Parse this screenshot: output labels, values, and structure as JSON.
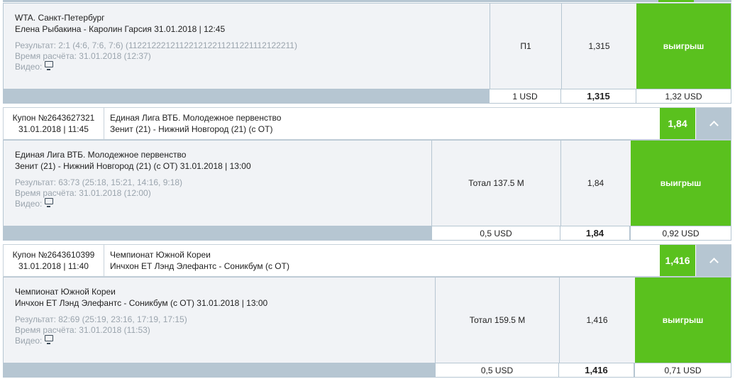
{
  "bet1": {
    "league": "WTA. Санкт-Петербург",
    "match": "Елена Рыбакина - Каролин Гарсия 31.01.2018 | 12:45",
    "result": "Результат: 2:1 (4:6, 7:6, 7:6) (112212221211221212211211221112122211)",
    "calc_time": "Время расчёта: 31.01.2018 (12:37)",
    "video_label": "Видео:",
    "outcome": "П1",
    "odds": "1,315",
    "status": "выигрыш",
    "stake": "1 USD",
    "total_odds": "1,315",
    "payout": "1,32 USD"
  },
  "coupon2": {
    "number": "Купон №2643627321",
    "date": "31.01.2018 | 11:45",
    "league": "Единая Лига ВТБ. Молодежное первенство",
    "teams": "Зенит (21) - Нижний Новгород (21) (с ОТ)",
    "coef": "1,84",
    "bet": {
      "league": "Единая Лига ВТБ. Молодежное первенство",
      "match": "Зенит (21) - Нижний Новгород (21) (с ОТ) 31.01.2018 | 13:00",
      "result": "Результат: 63:73 (25:18, 15:21, 14:16, 9:18)",
      "calc_time": "Время расчёта: 31.01.2018 (12:00)",
      "video_label": "Видео:",
      "outcome": "Тотал 137.5 М",
      "odds": "1,84",
      "status": "выигрыш",
      "stake": "0,5 USD",
      "total_odds": "1,84",
      "payout": "0,92 USD"
    }
  },
  "coupon3": {
    "number": "Купон №2643610399",
    "date": "31.01.2018 | 11:40",
    "league": "Чемпионат Южной Кореи",
    "teams": "Инчхон ЕТ Лэнд Элефантс - Соникбум (с ОТ)",
    "coef": "1,416",
    "bet": {
      "league": "Чемпионат Южной Кореи",
      "match": "Инчхон ЕТ Лэнд Элефантс - Соникбум (с ОТ) 31.01.2018 | 13:00",
      "result": "Результат: 82:69 (25:19, 23:16, 17:19, 17:15)",
      "calc_time": "Время расчёта: 31.01.2018 (11:53)",
      "video_label": "Видео:",
      "outcome": "Тотал 159.5 М",
      "odds": "1,416",
      "status": "выигрыш",
      "stake": "0,5 USD",
      "total_odds": "1,416",
      "payout": "0,71 USD"
    }
  },
  "colors": {
    "win_green": "#5ac11e",
    "footer_blue": "#b6c6d2",
    "panel_bg": "#f1f3f6"
  }
}
